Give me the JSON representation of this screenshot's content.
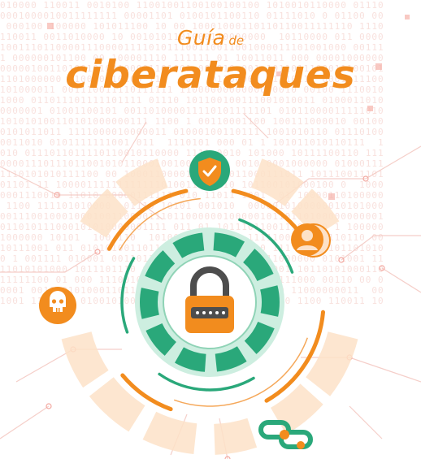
{
  "title": {
    "line1_main": "Guía",
    "line1_small": "de",
    "line2": "ciberataques"
  },
  "icons": {
    "center": "padlock-icon",
    "top": "shield-check-icon",
    "right": "user-avatar-icon",
    "left": "skull-icon",
    "bottom": "chain-link-icon"
  },
  "colors": {
    "orange": "#f28c1e",
    "green": "#2aa87a",
    "green_light": "#bfe9d8",
    "peach": "#fde2c8",
    "binary": "#f4c9c3",
    "dark": "#4d4d4d"
  }
}
